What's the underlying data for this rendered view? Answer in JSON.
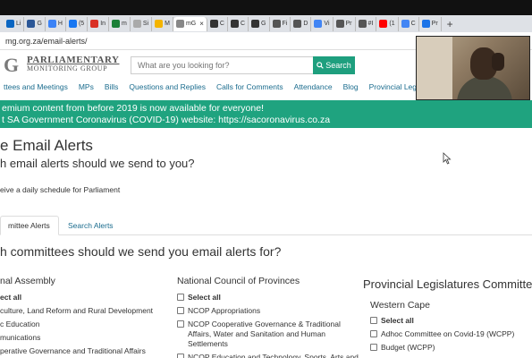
{
  "browser": {
    "tabs": [
      {
        "label": "Li",
        "color": "#0a66c2"
      },
      {
        "label": "G",
        "color": "#2b5797"
      },
      {
        "label": "H",
        "color": "#3b82f6"
      },
      {
        "label": "(5",
        "color": "#1877f2"
      },
      {
        "label": "In",
        "color": "#d93025"
      },
      {
        "label": "m",
        "color": "#1a7f37"
      },
      {
        "label": "Si",
        "color": "#aaaaaa"
      },
      {
        "label": "M",
        "color": "#f4b400"
      },
      {
        "label": "mG",
        "color": "#888888",
        "active": true
      },
      {
        "label": "C",
        "color": "#333333"
      },
      {
        "label": "C",
        "color": "#333333"
      },
      {
        "label": "G",
        "color": "#333333"
      },
      {
        "label": "Fi",
        "color": "#555555"
      },
      {
        "label": "D",
        "color": "#555555"
      },
      {
        "label": "Vi",
        "color": "#4285f4"
      },
      {
        "label": "Pr",
        "color": "#555555"
      },
      {
        "label": "#I",
        "color": "#555555"
      },
      {
        "label": "(1",
        "color": "#ff0000"
      },
      {
        "label": "C",
        "color": "#4285f4"
      },
      {
        "label": "Pr",
        "color": "#1a73e8"
      }
    ],
    "new_tab": "+",
    "url": "mg.org.za/email-alerts/"
  },
  "header": {
    "logo_letter": "G",
    "logo_line1": "PARLIAMENTARY",
    "logo_line2": "MONITORING GROUP",
    "search_placeholder": "What are you looking for?",
    "search_button": "Search"
  },
  "nav": {
    "items": [
      "ttees and Meetings",
      "MPs",
      "Bills",
      "Questions and Replies",
      "Calls for Comments",
      "Attendance",
      "Blog",
      "Provincial Legislatures"
    ]
  },
  "banner": {
    "line1": "emium content from before 2019 is now available for everyone!",
    "line2": "t SA Government Coronavirus (COVID-19) website: https://sacoronavirus.co.za"
  },
  "content": {
    "title": "e Email Alerts",
    "question1": "h email alerts should we send to you?",
    "daily_schedule": "eive a daily schedule for Parliament",
    "tab_committee": "mittee Alerts",
    "tab_search": "Search Alerts",
    "question2": "h committees should we send you email alerts for?"
  },
  "columns": {
    "national_assembly": {
      "title": "nal Assembly",
      "items": [
        "ect all",
        "culture, Land Reform and Rural Development",
        "c Education",
        "munications",
        "perative Governance and Traditional Affairs"
      ]
    },
    "ncop": {
      "title": "National Council of Provinces",
      "items": [
        "Select all",
        "NCOP Appropriations",
        "NCOP Cooperative Governance & Traditional Affairs, Water and Sanitation and Human Settlements",
        "NCOP Education and Technology, Sports, Arts and"
      ]
    },
    "provincial": {
      "title": "Provincial Legislatures Committee",
      "subtitle": "Western Cape",
      "items": [
        "Select all",
        "Adhoc Committee on Covid-19 (WCPP)",
        "Budget (WCPP)"
      ]
    }
  }
}
